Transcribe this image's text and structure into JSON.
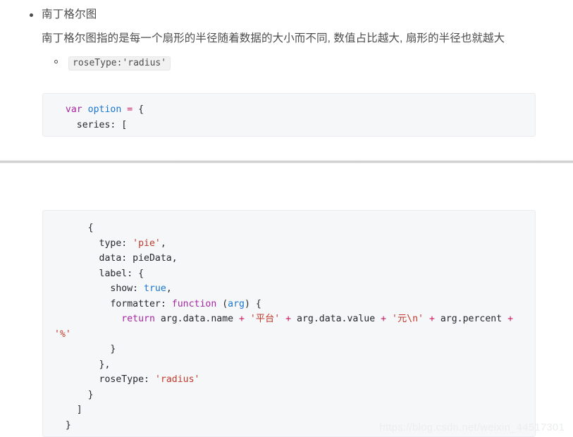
{
  "article": {
    "bullet": {
      "title": "南丁格尔图",
      "paragraph": "南丁格尔图指的是每一个扇形的半径随着数据的大小而不同, 数值占比越大, 扇形的半径也就越大",
      "sub_items": [
        {
          "code": "roseType:'radius'"
        }
      ]
    }
  },
  "code_block_1": {
    "language": "javascript",
    "lines": [
      {
        "segments": [
          {
            "text": "  ",
            "type": "plain"
          },
          {
            "text": "var",
            "type": "keyword"
          },
          {
            "text": " ",
            "type": "plain"
          },
          {
            "text": "option",
            "type": "variable"
          },
          {
            "text": " ",
            "type": "plain"
          },
          {
            "text": "=",
            "type": "operator"
          },
          {
            "text": " {",
            "type": "plain"
          }
        ]
      },
      {
        "segments": [
          {
            "text": "    series: [",
            "type": "plain"
          }
        ]
      }
    ],
    "plain_text": "  var option = {\n    series: ["
  },
  "code_block_2": {
    "language": "javascript",
    "lines": [
      {
        "segments": [
          {
            "text": "      {",
            "type": "plain"
          }
        ]
      },
      {
        "segments": [
          {
            "text": "        type: ",
            "type": "plain"
          },
          {
            "text": "'pie'",
            "type": "string"
          },
          {
            "text": ",",
            "type": "plain"
          }
        ]
      },
      {
        "segments": [
          {
            "text": "        data: pieData,",
            "type": "plain"
          }
        ]
      },
      {
        "segments": [
          {
            "text": "        label: {",
            "type": "plain"
          }
        ]
      },
      {
        "segments": [
          {
            "text": "          show: ",
            "type": "plain"
          },
          {
            "text": "true",
            "type": "variable"
          },
          {
            "text": ",",
            "type": "plain"
          }
        ]
      },
      {
        "segments": [
          {
            "text": "          formatter: ",
            "type": "plain"
          },
          {
            "text": "function",
            "type": "keyword"
          },
          {
            "text": " (",
            "type": "plain"
          },
          {
            "text": "arg",
            "type": "variable"
          },
          {
            "text": ") {",
            "type": "plain"
          }
        ]
      },
      {
        "segments": [
          {
            "text": "            ",
            "type": "plain"
          },
          {
            "text": "return",
            "type": "keyword"
          },
          {
            "text": " arg.data.name ",
            "type": "plain"
          },
          {
            "text": "+",
            "type": "operator"
          },
          {
            "text": " ",
            "type": "plain"
          },
          {
            "text": "'平台'",
            "type": "string"
          },
          {
            "text": " ",
            "type": "plain"
          },
          {
            "text": "+",
            "type": "operator"
          },
          {
            "text": " arg.data.value ",
            "type": "plain"
          },
          {
            "text": "+",
            "type": "operator"
          },
          {
            "text": " ",
            "type": "plain"
          },
          {
            "text": "'元\\n'",
            "type": "string"
          },
          {
            "text": " ",
            "type": "plain"
          },
          {
            "text": "+",
            "type": "operator"
          },
          {
            "text": " arg.percent ",
            "type": "plain"
          },
          {
            "text": "+",
            "type": "operator"
          },
          {
            "text": " ",
            "type": "plain"
          },
          {
            "text": "'%'",
            "type": "string"
          }
        ]
      },
      {
        "segments": [
          {
            "text": "          }",
            "type": "plain"
          }
        ]
      },
      {
        "segments": [
          {
            "text": "        },",
            "type": "plain"
          }
        ]
      },
      {
        "segments": [
          {
            "text": "        roseType: ",
            "type": "plain"
          },
          {
            "text": "'radius'",
            "type": "string"
          }
        ]
      },
      {
        "segments": [
          {
            "text": "      }",
            "type": "plain"
          }
        ]
      },
      {
        "segments": [
          {
            "text": "    ]",
            "type": "plain"
          }
        ]
      },
      {
        "segments": [
          {
            "text": "  }",
            "type": "plain"
          }
        ]
      }
    ],
    "plain_text": "      {\n        type: 'pie',\n        data: pieData,\n        label: {\n          show: true,\n          formatter: function (arg) {\n            return arg.data.name + '平台' + arg.data.value + '元\\n' + arg.percent + '%'\n          }\n        },\n        roseType: 'radius'\n      }\n    ]\n  }"
  },
  "watermark": {
    "text": "https://blog.csdn.net/weixin_44517301"
  },
  "colors": {
    "text": "#4d4d4d",
    "code_bg": "#f6f7f8",
    "code_border": "#eaecef",
    "keyword": "#a626a4",
    "operator": "#c2185b",
    "variable": "#1976d2",
    "string": "#c0392b",
    "watermark": "#eceef0",
    "divider": "#c9c9c9"
  }
}
